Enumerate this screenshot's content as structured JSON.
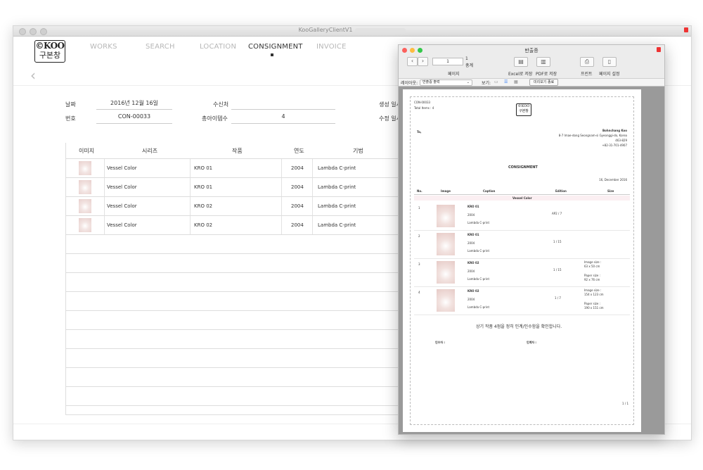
{
  "window": {
    "title": "KooGalleryClientV1"
  },
  "logo": {
    "line1": "©KOO",
    "line2": "구본창"
  },
  "nav": {
    "items": [
      "WORKS",
      "SEARCH",
      "LOCATION",
      "CONSIGNMENT",
      "INVOICE"
    ],
    "active": "CONSIGNMENT"
  },
  "form": {
    "date_label": "날짜",
    "date_value": "2016년 12월 16일",
    "number_label": "번호",
    "number_value": "CON-00033",
    "recipient_label": "수신처",
    "recipient_value": "",
    "total_items_label": "총아이템수",
    "total_items_value": "4",
    "created_label": "생성 일시",
    "modified_label": "수정 일시"
  },
  "table": {
    "headers": [
      "이미지",
      "시리즈",
      "작품",
      "연도",
      "기법"
    ],
    "rows": [
      {
        "series": "Vessel Color",
        "work": "KRO 01",
        "year": "2004",
        "technique": "Lambda C-print"
      },
      {
        "series": "Vessel Color",
        "work": "KRO 01",
        "year": "2004",
        "technique": "Lambda C-print"
      },
      {
        "series": "Vessel Color",
        "work": "KRO 02",
        "year": "2004",
        "technique": "Lambda C-print"
      },
      {
        "series": "Vessel Color",
        "work": "KRO 02",
        "year": "2004",
        "technique": "Lambda C-print"
      }
    ]
  },
  "preview": {
    "title": "반출증",
    "page_field": "1",
    "total_pages": "1",
    "total_label": "총계",
    "page_label": "페이지",
    "excel_label": "Excel로 저장",
    "pdf_label": "PDF로 저장",
    "print_label": "프린트",
    "page_setup_label": "페이지 설정",
    "layout_label": "레이아웃:",
    "layout_value": "반출증 출력",
    "view_label": "보기:",
    "exit_label": "미리보기 종료"
  },
  "document": {
    "con_no": "CON-00033",
    "total_items": "Total Items : 4",
    "logo_line1": "©KOO",
    "logo_line2": "구본창",
    "to_label": "To,",
    "sender_name": "Bohnchang Koo",
    "sender_address": "8-7 Imae-dong Seongnam-si Gyeonggi-do, Korea",
    "sender_zip": "463-829",
    "sender_phone": "+82-31-701-4907",
    "title": "CONSIGNMENT",
    "date": "16, December 2016",
    "col_no": "No.",
    "col_image": "Image",
    "col_caption": "Caption",
    "col_edition": "Edition",
    "col_size": "Size",
    "series": "Vessel Color",
    "items": [
      {
        "no": "1",
        "title": "KRO 01",
        "year": "2004",
        "technique": "Lambda C-print",
        "edition": "AP2 / 7",
        "img_size_label": "",
        "img_size": "",
        "paper_label": "",
        "paper_size": ""
      },
      {
        "no": "2",
        "title": "KRO 01",
        "year": "2004",
        "technique": "Lambda C-print",
        "edition": "1 / 15",
        "img_size_label": "",
        "img_size": "",
        "paper_label": "",
        "paper_size": ""
      },
      {
        "no": "3",
        "title": "KRO 02",
        "year": "2004",
        "technique": "Lambda C-print",
        "edition": "1 / 15",
        "img_size_label": "Image size :",
        "img_size": "63 x 50 cm",
        "paper_label": "Paper size :",
        "paper_size": "92 x 76 cm"
      },
      {
        "no": "4",
        "title": "KRO 02",
        "year": "2004",
        "technique": "Lambda C-print",
        "edition": "1 / 7",
        "img_size_label": "Image size :",
        "img_size": "154 x 123 cm",
        "paper_label": "Paper size :",
        "paper_size": "190 x 151 cm"
      }
    ],
    "confirm_text": "상기 작품 4점을 정히 인계/인수함을 확인합니다.",
    "receiver_label": "인수자 :",
    "giver_label": "인계자 :",
    "page_num": "1 / 1"
  }
}
